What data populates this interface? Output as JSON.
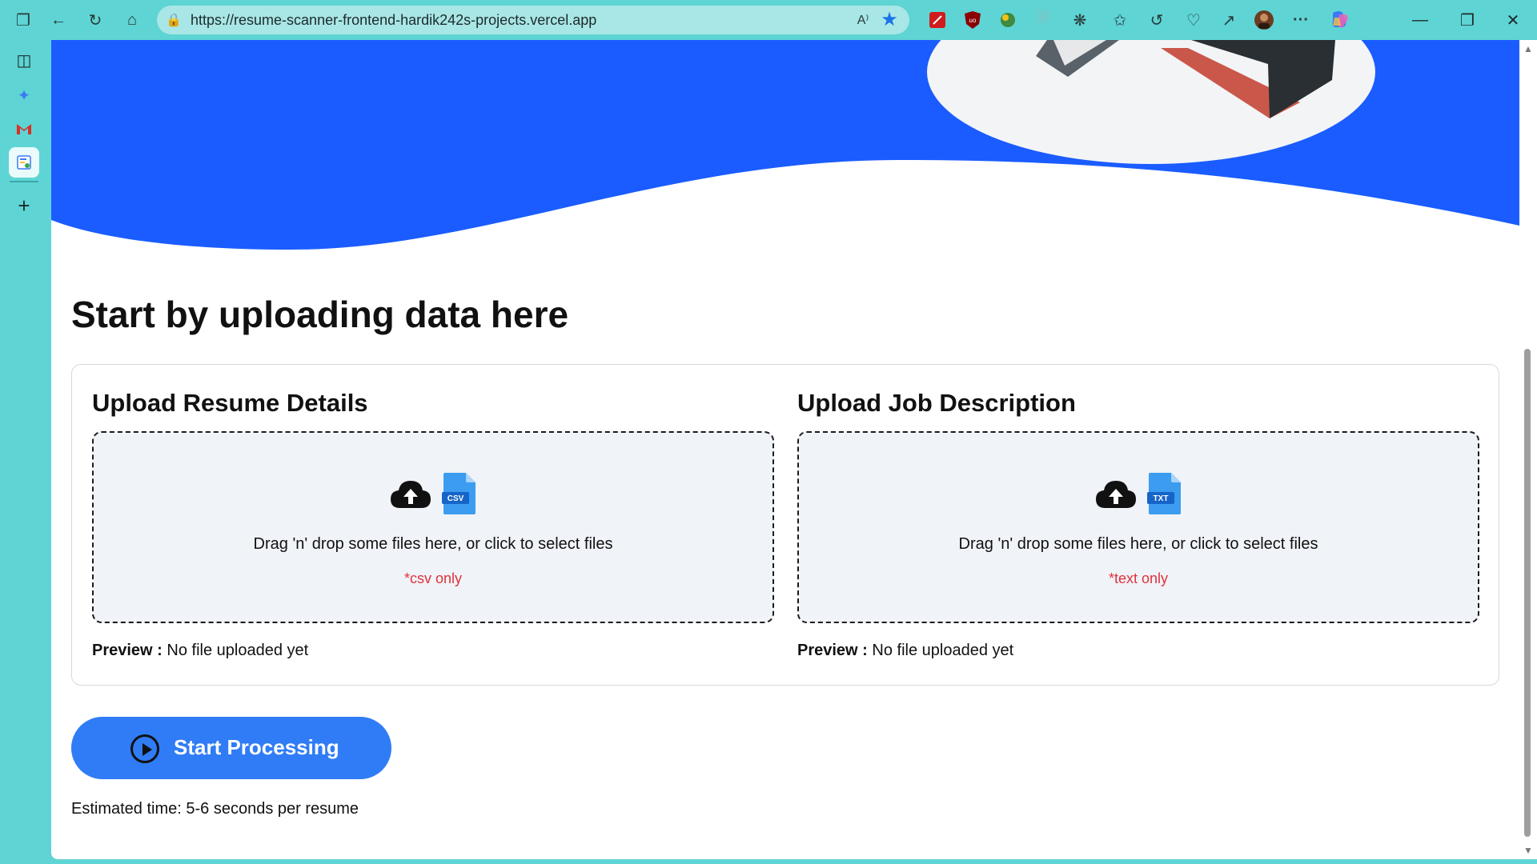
{
  "browser": {
    "url": "https://resume-scanner-frontend-hardik242s-projects.vercel.app",
    "read_aloud": "A⁾",
    "win_minimize": "—",
    "win_restore": "❐",
    "win_close": "✕",
    "menu": "···"
  },
  "page": {
    "title": "Start by uploading data here",
    "resume": {
      "title": "Upload Resume Details",
      "drop_text": "Drag 'n' drop some files here, or click to select files",
      "note": "*csv only",
      "file_badge": "CSV",
      "preview_label": "Preview :",
      "preview_value": "No file uploaded yet"
    },
    "job": {
      "title": "Upload Job Description",
      "drop_text": "Drag 'n' drop some files here, or click to select files",
      "note": "*text only",
      "file_badge": "TXT",
      "preview_label": "Preview :",
      "preview_value": "No file uploaded yet"
    },
    "start_button": "Start Processing",
    "estimate": "Estimated time: 5-6 seconds per resume"
  },
  "colors": {
    "hero_blue": "#1a5cff",
    "button_blue": "#2f7cf6",
    "note_red": "#e0323a",
    "frame_teal": "#5fd4d4"
  }
}
